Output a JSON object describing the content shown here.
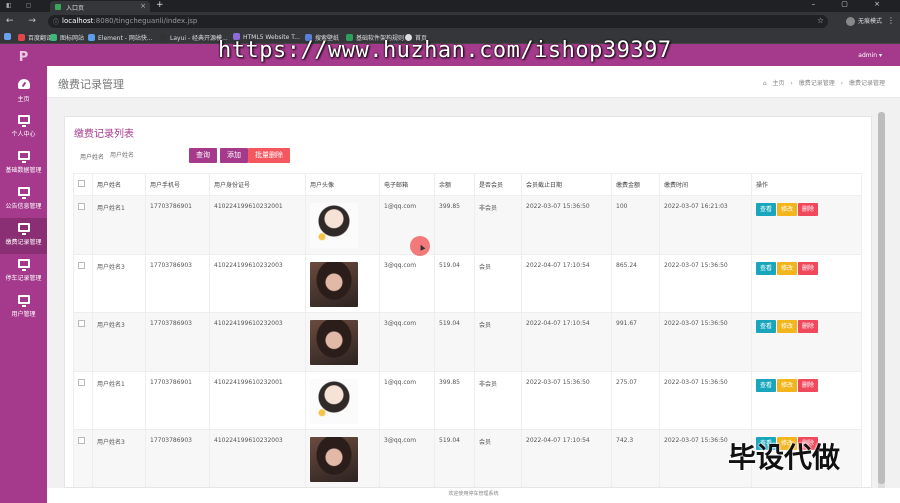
{
  "browser": {
    "tab_title": "入口页",
    "url_host": "localhost",
    "url_path": ":8080/tingcheguanli/index.jsp",
    "profile_label": "无痕模式",
    "bookmarks": [
      "百度翻译",
      "图标网站",
      "Element - 网站快...",
      "Layui - 经典开源模...",
      "HTML5 Website T...",
      "搜索壁纸",
      "基础软件架构规则",
      "首页"
    ]
  },
  "app": {
    "logo": "P",
    "admin_label": "admin ▾",
    "sidebar": [
      {
        "label": "主页",
        "icon": "dashboard-icon"
      },
      {
        "label": "个人中心",
        "icon": "monitor-icon"
      },
      {
        "label": "基础数据管理",
        "icon": "monitor-icon"
      },
      {
        "label": "公告信息管理",
        "icon": "monitor-icon"
      },
      {
        "label": "缴费记录管理",
        "icon": "monitor-icon"
      },
      {
        "label": "停车记录管理",
        "icon": "monitor-icon"
      },
      {
        "label": "用户管理",
        "icon": "monitor-icon"
      }
    ],
    "page_title": "缴费记录管理",
    "breadcrumb": {
      "home": "主页",
      "sep": "›",
      "level1": "缴费记录管理",
      "level2": "缴费记录管理"
    },
    "panel_title": "缴费记录列表",
    "search": {
      "label": "用户姓名",
      "placeholder": "用户姓名"
    },
    "buttons": {
      "query": "查询",
      "add": "添加",
      "batch_delete": "批量删除"
    },
    "table": {
      "headers": [
        "用户姓名",
        "用户手机号",
        "用户身份证号",
        "用户头像",
        "电子邮箱",
        "余额",
        "是否会员",
        "会员截止日期",
        "缴费金额",
        "缴费时间",
        "操作"
      ],
      "rows": [
        {
          "name": "用户姓名1",
          "phone": "17703786901",
          "idcard": "410224199610232001",
          "avatar": "cartoon",
          "email": "1@qq.com",
          "balance": "399.85",
          "member": "非会员",
          "expire": "2022-03-07 15:36:50",
          "amount": "100",
          "paytime": "2022-03-07 16:21:03"
        },
        {
          "name": "用户姓名3",
          "phone": "17703786903",
          "idcard": "410224199610232003",
          "avatar": "photo",
          "email": "3@qq.com",
          "balance": "519.04",
          "member": "会员",
          "expire": "2022-04-07 17:10:54",
          "amount": "865.24",
          "paytime": "2022-03-07 15:36:50"
        },
        {
          "name": "用户姓名3",
          "phone": "17703786903",
          "idcard": "410224199610232003",
          "avatar": "photo",
          "email": "3@qq.com",
          "balance": "519.04",
          "member": "会员",
          "expire": "2022-04-07 17:10:54",
          "amount": "991.67",
          "paytime": "2022-03-07 15:36:50"
        },
        {
          "name": "用户姓名1",
          "phone": "17703786901",
          "idcard": "410224199610232001",
          "avatar": "cartoon",
          "email": "1@qq.com",
          "balance": "399.85",
          "member": "非会员",
          "expire": "2022-03-07 15:36:50",
          "amount": "275.07",
          "paytime": "2022-03-07 15:36:50"
        },
        {
          "name": "用户姓名3",
          "phone": "17703786903",
          "idcard": "410224199610232003",
          "avatar": "photo",
          "email": "3@qq.com",
          "balance": "519.04",
          "member": "会员",
          "expire": "2022-04-07 17:10:54",
          "amount": "742.3",
          "paytime": "2022-03-07 15:36:50"
        }
      ],
      "op_labels": {
        "view": "查看",
        "edit": "修改",
        "delete": "删除"
      }
    },
    "footer": "欢迎使用停车管理系统"
  },
  "watermarks": {
    "url_overlay": "https://www.huzhan.com/ishop39397",
    "cn_overlay": "毕设代做"
  }
}
